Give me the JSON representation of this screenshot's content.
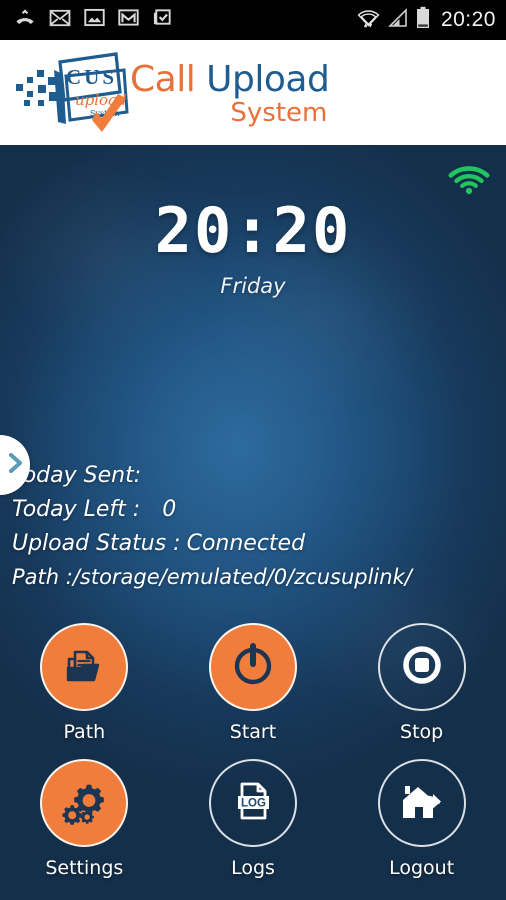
{
  "statusbar": {
    "left_icons": [
      {
        "name": "missed-call-icon"
      },
      {
        "name": "envelope-icon"
      },
      {
        "name": "image-icon"
      },
      {
        "name": "gmail-icon"
      },
      {
        "name": "clipboard-check-icon"
      }
    ],
    "right_icons": [
      {
        "name": "wifi-data-icon"
      },
      {
        "name": "cell-signal-icon"
      },
      {
        "name": "battery-icon"
      }
    ],
    "clock": "20:20"
  },
  "header": {
    "logo_mark_name": "cus-upload-system-logo",
    "brand_word1": "Call",
    "brand_word2": "Upload",
    "brand_word3": "System"
  },
  "main": {
    "connection_icon": "wifi-icon",
    "connection_color": "#22c55e",
    "clock_time": "20:20",
    "clock_day": "Friday",
    "drawer_handle_icon": "chevron-right-icon",
    "status": [
      {
        "label": "Today Sent:",
        "value": ""
      },
      {
        "label": "Today Left :",
        "value": "0"
      },
      {
        "label": "Upload Status :",
        "value": "Connected"
      },
      {
        "label": "Path :/storage/emulated/0/zcusuplink/",
        "value": ""
      }
    ],
    "buttons": [
      {
        "label": "Path",
        "icon": "folder-documents-icon",
        "style": "filled"
      },
      {
        "label": "Start",
        "icon": "power-icon",
        "style": "filled"
      },
      {
        "label": "Stop",
        "icon": "stop-icon",
        "style": "outline"
      },
      {
        "label": "Settings",
        "icon": "gears-icon",
        "style": "filled"
      },
      {
        "label": "Logs",
        "icon": "log-file-icon",
        "style": "outline"
      },
      {
        "label": "Logout",
        "icon": "house-exit-icon",
        "style": "outline"
      }
    ]
  },
  "colors": {
    "accent_orange": "#f07d3c",
    "brand_blue": "#1f5d91",
    "status_green": "#22c55e",
    "bg_dark_navy": "#142f4a"
  }
}
